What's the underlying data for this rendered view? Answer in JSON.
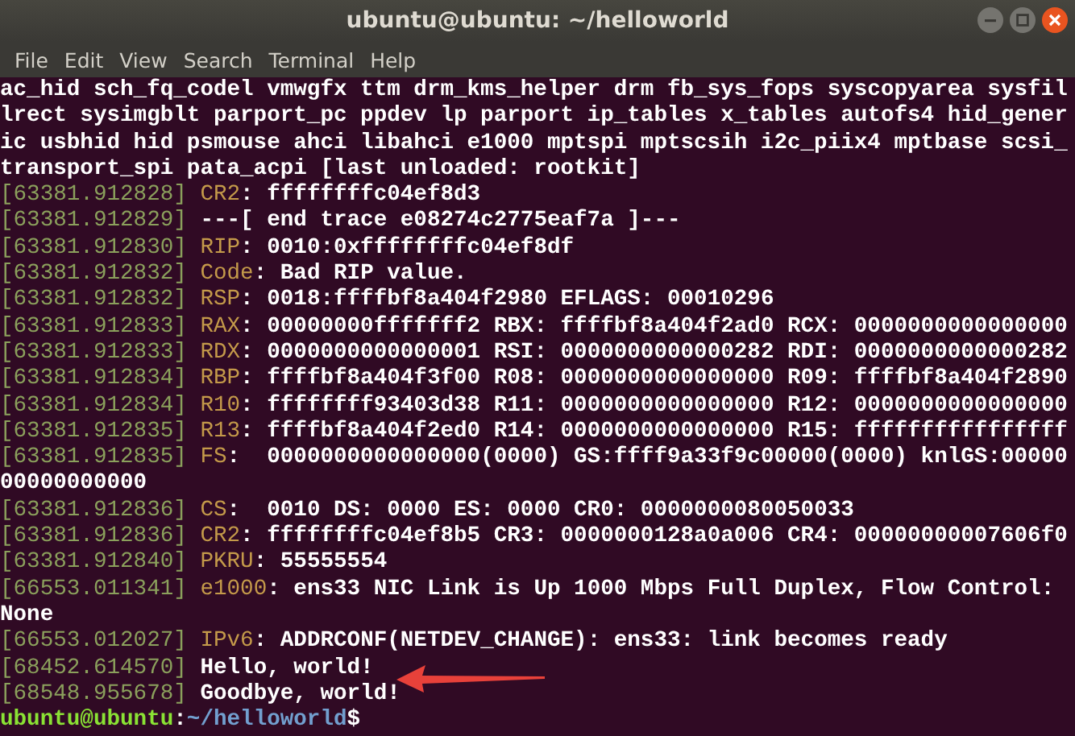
{
  "window": {
    "title": "ubuntu@ubuntu: ~/helloworld"
  },
  "menu": [
    "File",
    "Edit",
    "View",
    "Search",
    "Terminal",
    "Help"
  ],
  "lines": [
    {
      "kind": "plain",
      "text": "ac_hid sch_fq_codel vmwgfx ttm drm_kms_helper drm fb_sys_fops syscopyarea sysfil"
    },
    {
      "kind": "plain",
      "text": "lrect sysimgblt parport_pc ppdev lp parport ip_tables x_tables autofs4 hid_gener"
    },
    {
      "kind": "plain",
      "text": "ic usbhid hid psmouse ahci libahci e1000 mptspi mptscsih i2c_piix4 mptbase scsi_"
    },
    {
      "kind": "plain",
      "text": "transport_spi pata_acpi [last unloaded: rootkit]"
    },
    {
      "kind": "log",
      "time": "[63381.912828]",
      "tag": "CR2",
      "text": ": ffffffffc04ef8d3"
    },
    {
      "kind": "log",
      "time": "[63381.912829]",
      "text": "---[ end trace e08274c2775eaf7a ]---"
    },
    {
      "kind": "log",
      "time": "[63381.912830]",
      "tag": "RIP",
      "text": ": 0010:0xffffffffc04ef8df"
    },
    {
      "kind": "log",
      "time": "[63381.912832]",
      "tag": "Code",
      "text": ": Bad RIP value."
    },
    {
      "kind": "log",
      "time": "[63381.912832]",
      "tag": "RSP",
      "text": ": 0018:ffffbf8a404f2980 EFLAGS: 00010296"
    },
    {
      "kind": "log",
      "time": "[63381.912833]",
      "tag": "RAX",
      "text": ": 00000000fffffff2 RBX: ffffbf8a404f2ad0 RCX: 0000000000000000"
    },
    {
      "kind": "log",
      "time": "[63381.912833]",
      "tag": "RDX",
      "text": ": 0000000000000001 RSI: 0000000000000282 RDI: 0000000000000282"
    },
    {
      "kind": "log",
      "time": "[63381.912834]",
      "tag": "RBP",
      "text": ": ffffbf8a404f3f00 R08: 0000000000000000 R09: ffffbf8a404f2890"
    },
    {
      "kind": "log",
      "time": "[63381.912834]",
      "tag": "R10",
      "text": ": ffffffff93403d38 R11: 0000000000000000 R12: 0000000000000000"
    },
    {
      "kind": "log",
      "time": "[63381.912835]",
      "tag": "R13",
      "text": ": ffffbf8a404f2ed0 R14: 0000000000000000 R15: ffffffffffffffff"
    },
    {
      "kind": "log",
      "time": "[63381.912835]",
      "tag": "FS",
      "text": ":  0000000000000000(0000) GS:ffff9a33f9c00000(0000) knlGS:00000"
    },
    {
      "kind": "plain",
      "text": "00000000000"
    },
    {
      "kind": "log",
      "time": "[63381.912836]",
      "tag": "CS",
      "text": ":  0010 DS: 0000 ES: 0000 CR0: 0000000080050033"
    },
    {
      "kind": "log",
      "time": "[63381.912836]",
      "tag": "CR2",
      "text": ": ffffffffc04ef8b5 CR3: 0000000128a0a006 CR4: 00000000007606f0"
    },
    {
      "kind": "log",
      "time": "[63381.912840]",
      "tag": "PKRU",
      "text": ": 55555554"
    },
    {
      "kind": "log",
      "time": "[66553.011341]",
      "tag": "e1000",
      "text": ": ens33 NIC Link is Up 1000 Mbps Full Duplex, Flow Control:"
    },
    {
      "kind": "plain",
      "text": "None"
    },
    {
      "kind": "log",
      "time": "[66553.012027]",
      "tag": "IPv6",
      "text": ": ADDRCONF(NETDEV_CHANGE): ens33: link becomes ready"
    },
    {
      "kind": "log",
      "time": "[68452.614570]",
      "text": "Hello, world!"
    },
    {
      "kind": "log",
      "time": "[68548.955678]",
      "text": "Goodbye, world!"
    },
    {
      "kind": "prompt",
      "user": "ubuntu@ubuntu",
      "sep": ":",
      "path": "~/helloworld",
      "symbol": "$"
    }
  ]
}
